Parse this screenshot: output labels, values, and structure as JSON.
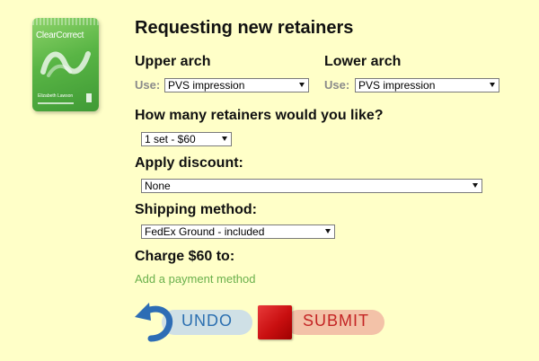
{
  "product": {
    "brand": "ClearCorrect",
    "caption": "Elizabeth Lawson"
  },
  "title": "Requesting new retainers",
  "upper_arch": {
    "heading": "Upper arch",
    "use_label": "Use:",
    "selected": "PVS impression"
  },
  "lower_arch": {
    "heading": "Lower arch",
    "use_label": "Use:",
    "selected": "PVS impression"
  },
  "retainers": {
    "heading": "How many retainers would you like?",
    "selected": "1 set - $60"
  },
  "discount": {
    "heading": "Apply discount:",
    "selected": "None"
  },
  "shipping": {
    "heading": "Shipping method:",
    "selected": "FedEx Ground - included"
  },
  "charge": {
    "heading": "Charge $60 to:",
    "link": "Add a payment method"
  },
  "buttons": {
    "undo": "UNDO",
    "submit": "SUBMIT"
  },
  "colors": {
    "background": "#ffffc8",
    "link": "#6ab04c",
    "undo_text": "#2b6fb0",
    "submit_text": "#c42424",
    "submit_square": "#c90f10"
  }
}
